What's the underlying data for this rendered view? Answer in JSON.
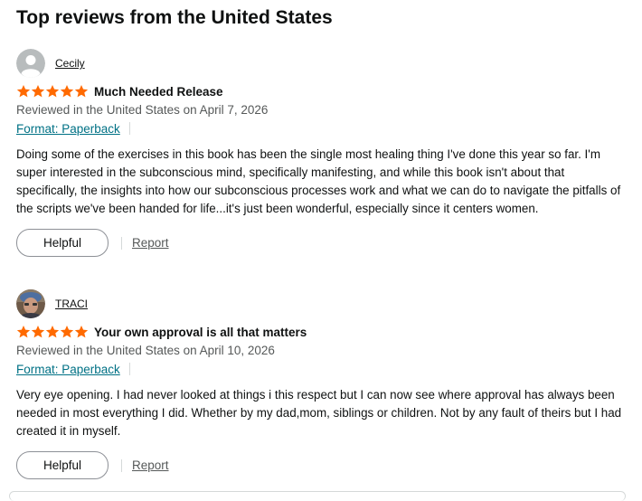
{
  "section": {
    "heading": "Top reviews from the United States"
  },
  "colors": {
    "star": "#ff6a00",
    "link": "#007185",
    "muted": "#565959",
    "text": "#0f1111"
  },
  "reviews": [
    {
      "reviewer": "Cecily",
      "avatar": "default-user-avatar",
      "rating": 5,
      "title": "Much Needed Release",
      "date": "Reviewed in the United States on April 7, 2026",
      "format": "Format: Paperback",
      "body": "Doing some of the exercises in this book has been the single most healing thing I've done this year so far. I'm super interested in the subconscious mind, specifically manifesting, and while this book isn't about that specifically, the insights into how our subconscious processes work and what we can do to navigate the pitfalls of the scripts we've been handed for life...it's just been wonderful, especially since it centers women.",
      "helpful_label": "Helpful",
      "report_label": "Report"
    },
    {
      "reviewer": "TRACI",
      "avatar": "profile-photo-avatar",
      "rating": 5,
      "title": "Your own approval is all that matters",
      "date": "Reviewed in the United States on April 10, 2026",
      "format": "Format: Paperback",
      "body": "Very eye opening. I had never looked at things i this respect but I can now see where approval has always been needed in most everything I did. Whether by my dad,mom, siblings or children. Not by any fault of theirs but I had created it in myself.",
      "helpful_label": "Helpful",
      "report_label": "Report"
    }
  ]
}
